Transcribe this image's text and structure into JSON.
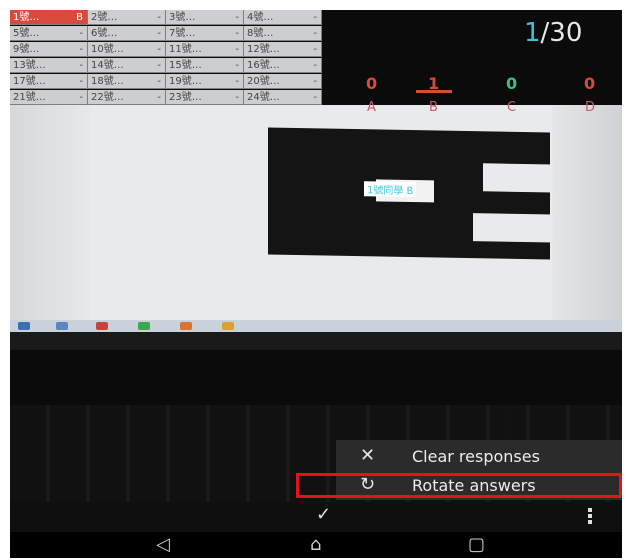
{
  "grid": {
    "rows": [
      [
        {
          "name": "1號…",
          "answer": "B"
        },
        {
          "name": "2號…",
          "answer": "-"
        },
        {
          "name": "3號…",
          "answer": "-"
        },
        {
          "name": "4號…",
          "answer": "-"
        }
      ],
      [
        {
          "name": "5號…",
          "answer": "-"
        },
        {
          "name": "6號…",
          "answer": "-"
        },
        {
          "name": "7號…",
          "answer": "-"
        },
        {
          "name": "8號…",
          "answer": "-"
        }
      ],
      [
        {
          "name": "9號…",
          "answer": "-"
        },
        {
          "name": "10號…",
          "answer": "-"
        },
        {
          "name": "11號…",
          "answer": "-"
        },
        {
          "name": "12號…",
          "answer": "-"
        }
      ],
      [
        {
          "name": "13號…",
          "answer": "-"
        },
        {
          "name": "14號…",
          "answer": "-"
        },
        {
          "name": "15號…",
          "answer": "-"
        },
        {
          "name": "16號…",
          "answer": "-"
        }
      ],
      [
        {
          "name": "17號…",
          "answer": "-"
        },
        {
          "name": "18號…",
          "answer": "-"
        },
        {
          "name": "19號…",
          "answer": "-"
        },
        {
          "name": "20號…",
          "answer": "-"
        }
      ],
      [
        {
          "name": "21號…",
          "answer": "-"
        },
        {
          "name": "22號…",
          "answer": "-"
        },
        {
          "name": "23號…",
          "answer": "-"
        },
        {
          "name": "24號…",
          "answer": "-"
        }
      ]
    ],
    "selected_color": "#d84b3c"
  },
  "counter": {
    "current": "1",
    "total": "/30",
    "accent": "#3fc2d6"
  },
  "answers": [
    {
      "letter": "A",
      "count": "0",
      "color": "#d84b3c"
    },
    {
      "letter": "B",
      "count": "1",
      "color": "#d84b3c"
    },
    {
      "letter": "C",
      "count": "0",
      "color": "#3fbf7f"
    },
    {
      "letter": "D",
      "count": "0",
      "color": "#d84b3c"
    }
  ],
  "marker_label": "1號同學 B",
  "menu": {
    "items": [
      {
        "icon": "close-icon",
        "glyph": "✕",
        "label": "Clear responses"
      },
      {
        "icon": "rotate-icon",
        "glyph": "↻",
        "label": "Rotate answers"
      }
    ]
  },
  "actionbar": {
    "check_glyph": "✓"
  },
  "navbar": {
    "back": "◁",
    "home": "⌂",
    "recents": "▢"
  }
}
